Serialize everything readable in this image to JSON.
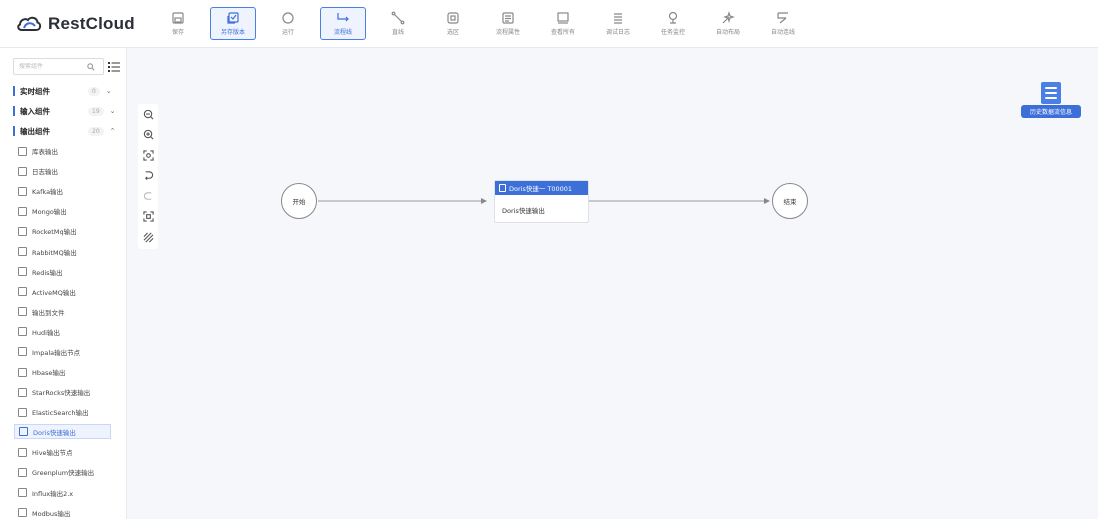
{
  "app": {
    "name": "RestCloud"
  },
  "toolbar": [
    {
      "label": "保存",
      "icon": "save-icon",
      "active": false
    },
    {
      "label": "另存版本",
      "icon": "save-version-icon",
      "active": true
    },
    {
      "label": "运行",
      "icon": "run-icon",
      "active": false
    },
    {
      "label": "流程线",
      "icon": "flow-line-icon",
      "active": true
    },
    {
      "label": "直线",
      "icon": "straight-line-icon",
      "active": false
    },
    {
      "label": "选区",
      "icon": "selection-icon",
      "active": false
    },
    {
      "label": "流程属性",
      "icon": "flow-properties-icon",
      "active": false
    },
    {
      "label": "查看所有",
      "icon": "view-all-icon",
      "active": false
    },
    {
      "label": "调试日志",
      "icon": "debug-log-icon",
      "active": false
    },
    {
      "label": "任务监控",
      "icon": "task-monitor-icon",
      "active": false
    },
    {
      "label": "自动布局",
      "icon": "auto-layout-icon",
      "active": false
    },
    {
      "label": "自动连线",
      "icon": "auto-connect-icon",
      "active": false
    }
  ],
  "sidebar": {
    "search_placeholder": "搜索组件",
    "groups": [
      {
        "name": "实时组件",
        "count": "0",
        "chevron": "⌄"
      },
      {
        "name": "输入组件",
        "count": "19",
        "chevron": "⌄"
      },
      {
        "name": "输出组件",
        "count": "20",
        "chevron": "⌃"
      }
    ],
    "items": [
      "库表输出",
      "日志输出",
      "Kafka输出",
      "Mongo输出",
      "RocketMq输出",
      "RabbitMQ输出",
      "Redis输出",
      "ActiveMQ输出",
      "输出到文件",
      "Hudi输出",
      "Impala输出节点",
      "Hbase输出",
      "StarRocks快速输出",
      "ElasticSearch输出",
      "Doris快速输出",
      "Hive输出节点",
      "Greenplum快速输出",
      "Influx输出2.x",
      "Modbus输出"
    ]
  },
  "canvas": {
    "start_label": "开始",
    "end_label": "结束",
    "node_title": "Doris快速一  T00001",
    "node_body": "Doris快速输出",
    "history_label": "历史数据流信息"
  },
  "colors": {
    "accent": "#3d6fd9"
  }
}
